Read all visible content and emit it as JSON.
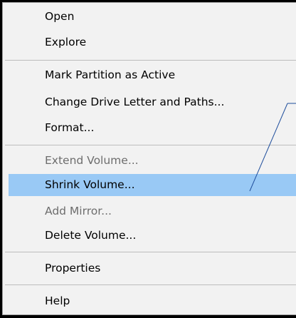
{
  "context_menu": {
    "items": [
      {
        "label": "Open",
        "enabled": true
      },
      {
        "label": "Explore",
        "enabled": true
      },
      {
        "label": "Mark Partition as Active",
        "enabled": true
      },
      {
        "label": "Change Drive Letter and Paths...",
        "enabled": true
      },
      {
        "label": "Format...",
        "enabled": true
      },
      {
        "label": "Extend Volume...",
        "enabled": false
      },
      {
        "label": "Shrink Volume...",
        "enabled": true,
        "highlighted": true
      },
      {
        "label": "Add Mirror...",
        "enabled": false
      },
      {
        "label": "Delete Volume...",
        "enabled": true
      },
      {
        "label": "Properties",
        "enabled": true
      },
      {
        "label": "Help",
        "enabled": true
      }
    ]
  },
  "colors": {
    "menu_background": "#f2f2f2",
    "highlight": "#99c9f5",
    "disabled_text": "#6d6d6d",
    "separator": "#bdbdbd",
    "annotation_line": "#1f4e9c"
  }
}
